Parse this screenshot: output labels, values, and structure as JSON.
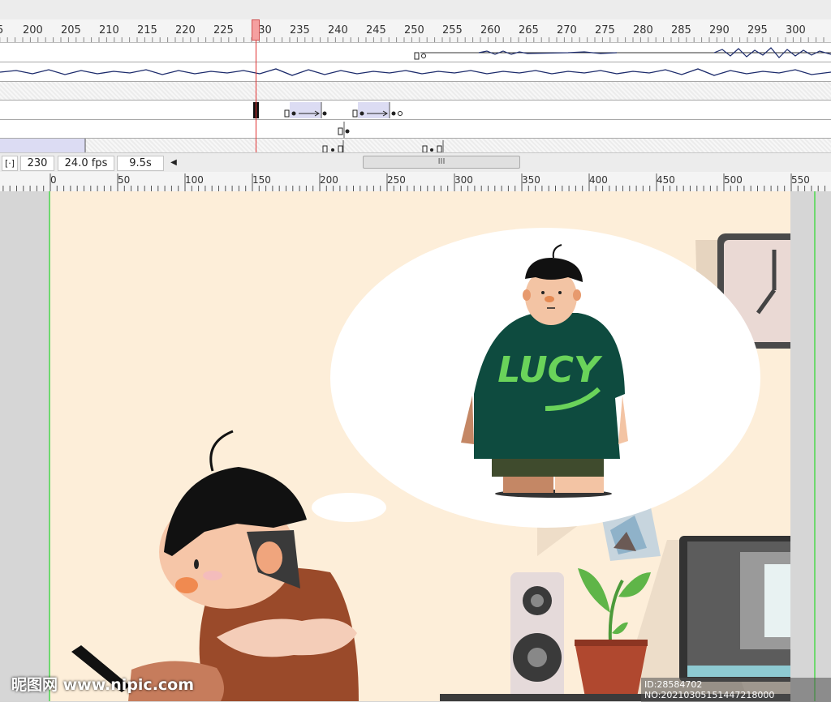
{
  "timeline": {
    "frame_numbers": [
      "5",
      "200",
      "205",
      "210",
      "215",
      "220",
      "225",
      "230",
      "235",
      "240",
      "245",
      "250",
      "255",
      "260",
      "265",
      "270",
      "275",
      "280",
      "285",
      "290",
      "295",
      "300"
    ],
    "current_frame": "230"
  },
  "status": {
    "frame": "230",
    "fps": "24.0 fps",
    "time": "9.5s",
    "center_frame_icon": "center-frame-icon",
    "scroll_left_arrow": "◀",
    "scroll_grip": "III"
  },
  "stage_ruler": {
    "labels": [
      "0",
      "50",
      "100",
      "150",
      "200",
      "250",
      "300",
      "350",
      "400",
      "450",
      "500",
      "550"
    ]
  },
  "artwork": {
    "shirt_text": "LUCY"
  },
  "watermark": {
    "logo": "昵图网 www.nipic.com",
    "id_text": "ID:28584702 NO:20210305151447218000"
  },
  "colors": {
    "stage": "#fdeed9",
    "playhead": "#e03030",
    "guide": "#6fd86f",
    "shirt": "#0e4b3f",
    "shirt_text": "#6ad35a"
  }
}
